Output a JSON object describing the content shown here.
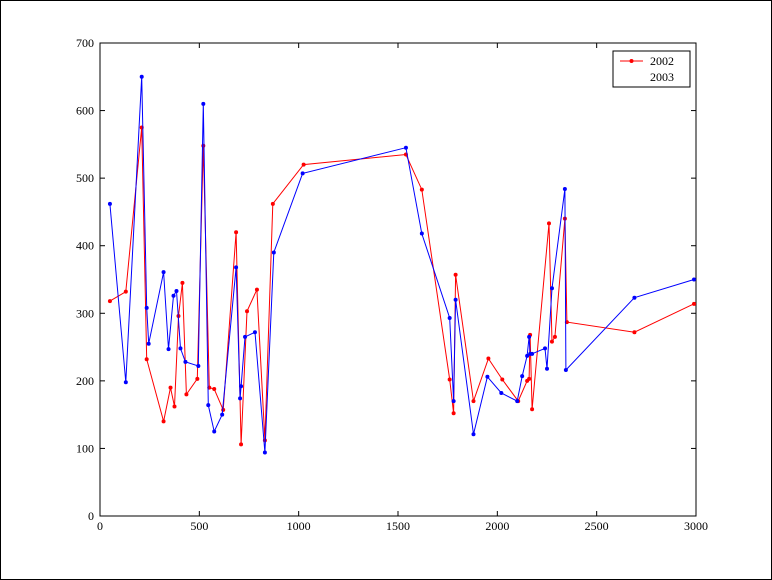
{
  "chart_data": {
    "type": "line",
    "title": "",
    "xlabel": "",
    "ylabel": "",
    "xlim": [
      0,
      3000
    ],
    "ylim": [
      0,
      700
    ],
    "x_ticks": [
      "0",
      "500",
      "1000",
      "1500",
      "2000",
      "2500",
      "3000"
    ],
    "y_ticks": [
      "0",
      "100",
      "200",
      "300",
      "400",
      "500",
      "600",
      "700"
    ],
    "grid": false,
    "legend_position": "top-right",
    "series": [
      {
        "name": "2002",
        "color": "#ff0000",
        "marker": "dot",
        "x": [
          50,
          130,
          210,
          235,
          320,
          355,
          375,
          395,
          415,
          435,
          490,
          520,
          550,
          575,
          620,
          685,
          710,
          740,
          790,
          830,
          870,
          1025,
          1540,
          1620,
          1760,
          1780,
          1790,
          1880,
          1955,
          2025,
          2105,
          2150,
          2160,
          2165,
          2175,
          2260,
          2275,
          2290,
          2340,
          2350,
          2690,
          2990
        ],
        "y": [
          318,
          332,
          575,
          232,
          140,
          190,
          162,
          296,
          345,
          180,
          203,
          548,
          190,
          188,
          157,
          420,
          106,
          303,
          335,
          112,
          462,
          520,
          535,
          483,
          202,
          152,
          357,
          170,
          233,
          202,
          170,
          200,
          203,
          268,
          158,
          433,
          258,
          265,
          440,
          287,
          272,
          314
        ]
      },
      {
        "name": "2003",
        "color": "#0000ff",
        "marker": "dot",
        "x": [
          50,
          130,
          210,
          235,
          245,
          320,
          345,
          370,
          385,
          405,
          430,
          495,
          520,
          545,
          575,
          615,
          685,
          705,
          710,
          730,
          780,
          830,
          875,
          1020,
          1540,
          1620,
          1760,
          1780,
          1790,
          1880,
          1950,
          2020,
          2100,
          2125,
          2150,
          2160,
          2165,
          2175,
          2240,
          2250,
          2275,
          2340,
          2345,
          2690,
          2990
        ],
        "y": [
          462,
          198,
          650,
          308,
          255,
          361,
          247,
          326,
          333,
          248,
          228,
          222,
          610,
          164,
          125,
          150,
          368,
          174,
          192,
          265,
          272,
          94,
          390,
          507,
          545,
          418,
          293,
          170,
          320,
          121,
          206,
          182,
          170,
          207,
          237,
          265,
          240,
          240,
          248,
          218,
          337,
          484,
          216,
          323,
          350
        ]
      }
    ]
  },
  "legend": {
    "items": [
      {
        "label": "2002",
        "color": "#ff0000",
        "show_line": true
      },
      {
        "label": "2003",
        "color": "#0000ff",
        "show_line": false
      }
    ]
  }
}
